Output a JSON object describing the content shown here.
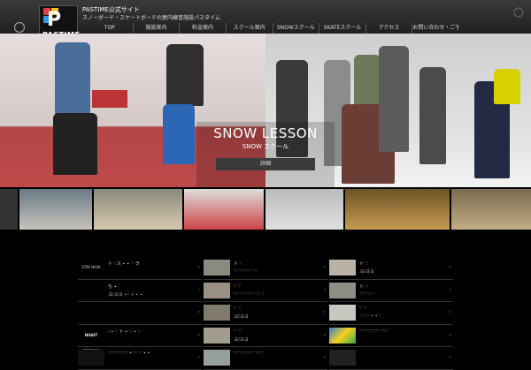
{
  "header": {
    "logo_text": "PASTIME",
    "site_title": "PASTIME公式サイト",
    "site_tagline": "スノーボード・スケートボードの屋内練習施設パスタイム"
  },
  "nav": [
    {
      "label": "TOP"
    },
    {
      "label": "施設案内"
    },
    {
      "label": "料金案内"
    },
    {
      "label": "スクール案内"
    },
    {
      "label": "SNOWスクール"
    },
    {
      "label": "SKATEスクール"
    },
    {
      "label": "アクセス"
    },
    {
      "label": "お問い合わせ・ご予約"
    }
  ],
  "hero": {
    "title": "SNOW LESSON",
    "subtitle": "SNOW スクール",
    "button": "詳細"
  },
  "lists": [
    [
      {
        "logo": "STAY HIGH",
        "t1": "ト ∵ス ∙ ∙ ∵ ラ",
        "t2": ""
      },
      {
        "logo": "",
        "t1": "ち ∙",
        "t2": "ヨ/ヨヨ ∙∵ ∙ ∙ ∙"
      },
      {
        "logo": "",
        "t1": "",
        "t2": ""
      },
      {
        "logo": "NIGHT SESSION",
        "t1": "∵∙ ∵ ト ∙ ∵ ∙ ∵",
        "t2": ""
      },
      {
        "logo": "",
        "t1": "∵∵∵∵∵∵∵ ∙∵∵ ∵ ∙ ∙",
        "t2": ""
      }
    ],
    [
      {
        "t1": "ト ∵",
        "t2": "∵∵∵∵∵∵ ∵∵"
      },
      {
        "t1": "∵ ∵",
        "t2": "∵∵∵∵∵∵∵ ∵∵ ∵"
      },
      {
        "t1": "∵ ∵",
        "t2": "ヨ/ヨヨ"
      },
      {
        "t1": "∵ ∵",
        "t2": "ヨ/ヨヨ"
      },
      {
        "t1": "∵∵∵∵∵∵∵ ∵∵∵",
        "t2": ""
      }
    ],
    [
      {
        "t1": "ト ∵",
        "t2": "ヨ/ヨヨ"
      },
      {
        "t1": "ト ∵",
        "t2": "∵∵∵∵∵"
      },
      {
        "t1": "∵ ∵",
        "t2": "∵∵ ∵ ∙ ∙ ∵"
      },
      {
        "t1": "∵∵∵∵∵∵∵ ∵∵∵",
        "t2": ""
      },
      {
        "t1": "",
        "t2": ""
      }
    ]
  ],
  "colors": {
    "accent": "#ffffff",
    "background": "#000000"
  }
}
